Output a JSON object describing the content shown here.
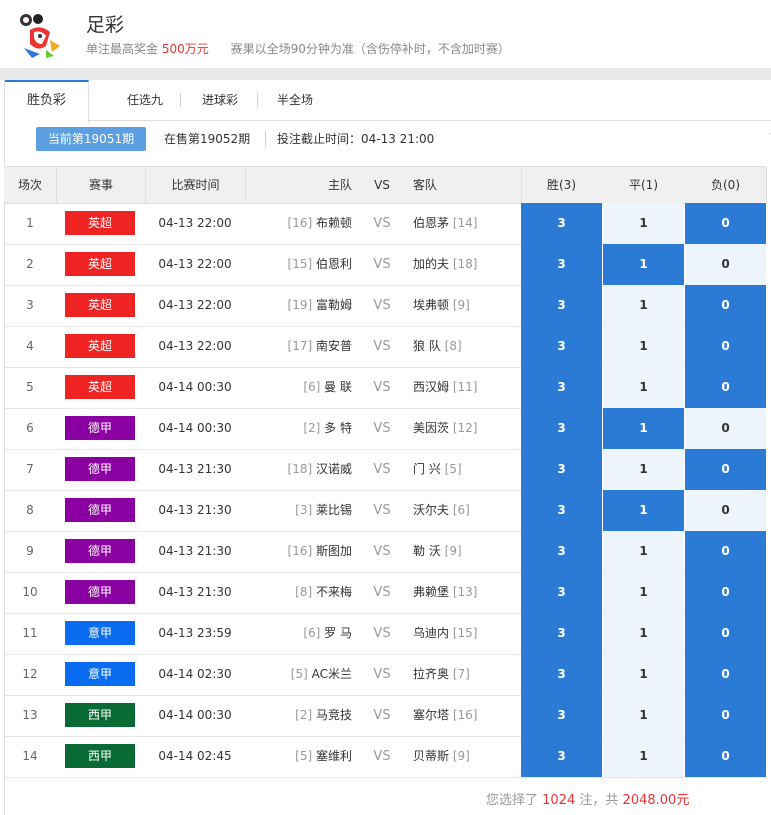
{
  "header": {
    "title": "足彩",
    "max_prize_label": "单注最高奖金",
    "max_prize_value": "500万元",
    "rule_note": "赛果以全场90分钟为准（含伤停补时，不含加时赛）"
  },
  "tabs": [
    {
      "label": "胜负彩"
    },
    {
      "label": "任选九"
    },
    {
      "label": "进球彩"
    },
    {
      "label": "半全场"
    }
  ],
  "issue": {
    "current": "当前第19051期",
    "on_sale": "在售第19052期",
    "deadline": "投注截止时间：04-13 21:00"
  },
  "table_headers": {
    "no": "场次",
    "league": "赛事",
    "time": "比赛时间",
    "home": "主队",
    "vs": "VS",
    "away": "客队",
    "win": "胜(3)",
    "draw": "平(1)",
    "lose": "负(0)"
  },
  "colors": {
    "英超": "#f02323",
    "德甲": "#8b00a0",
    "意甲": "#0a6cf0",
    "西甲": "#0a6a36",
    "selected": "#2b7bd6"
  },
  "matches": [
    {
      "no": "1",
      "league": "英超",
      "time": "04-13 22:00",
      "home_rank": "[16]",
      "home": "布赖顿",
      "away": "伯恩茅",
      "away_rank": "[14]",
      "win": "3",
      "draw": "1",
      "lose": "0",
      "sel": [
        1,
        0,
        1
      ]
    },
    {
      "no": "2",
      "league": "英超",
      "time": "04-13 22:00",
      "home_rank": "[15]",
      "home": "伯恩利",
      "away": "加的夫",
      "away_rank": "[18]",
      "win": "3",
      "draw": "1",
      "lose": "0",
      "sel": [
        1,
        1,
        0
      ]
    },
    {
      "no": "3",
      "league": "英超",
      "time": "04-13 22:00",
      "home_rank": "[19]",
      "home": "富勒姆",
      "away": "埃弗顿",
      "away_rank": "[9]",
      "win": "3",
      "draw": "1",
      "lose": "0",
      "sel": [
        1,
        0,
        1
      ]
    },
    {
      "no": "4",
      "league": "英超",
      "time": "04-13 22:00",
      "home_rank": "[17]",
      "home": "南安普",
      "away": "狼 队",
      "away_rank": "[8]",
      "win": "3",
      "draw": "1",
      "lose": "0",
      "sel": [
        1,
        0,
        1
      ]
    },
    {
      "no": "5",
      "league": "英超",
      "time": "04-14 00:30",
      "home_rank": "[6]",
      "home": "曼 联",
      "away": "西汉姆",
      "away_rank": "[11]",
      "win": "3",
      "draw": "1",
      "lose": "0",
      "sel": [
        1,
        0,
        1
      ]
    },
    {
      "no": "6",
      "league": "德甲",
      "time": "04-14 00:30",
      "home_rank": "[2]",
      "home": "多 特",
      "away": "美因茨",
      "away_rank": "[12]",
      "win": "3",
      "draw": "1",
      "lose": "0",
      "sel": [
        1,
        1,
        0
      ]
    },
    {
      "no": "7",
      "league": "德甲",
      "time": "04-13 21:30",
      "home_rank": "[18]",
      "home": "汉诺威",
      "away": "门 兴",
      "away_rank": "[5]",
      "win": "3",
      "draw": "1",
      "lose": "0",
      "sel": [
        1,
        0,
        1
      ]
    },
    {
      "no": "8",
      "league": "德甲",
      "time": "04-13 21:30",
      "home_rank": "[3]",
      "home": "莱比锡",
      "away": "沃尔夫",
      "away_rank": "[6]",
      "win": "3",
      "draw": "1",
      "lose": "0",
      "sel": [
        1,
        1,
        0
      ]
    },
    {
      "no": "9",
      "league": "德甲",
      "time": "04-13 21:30",
      "home_rank": "[16]",
      "home": "斯图加",
      "away": "勒 沃",
      "away_rank": "[9]",
      "win": "3",
      "draw": "1",
      "lose": "0",
      "sel": [
        1,
        0,
        1
      ]
    },
    {
      "no": "10",
      "league": "德甲",
      "time": "04-13 21:30",
      "home_rank": "[8]",
      "home": "不来梅",
      "away": "弗赖堡",
      "away_rank": "[13]",
      "win": "3",
      "draw": "1",
      "lose": "0",
      "sel": [
        1,
        0,
        1
      ]
    },
    {
      "no": "11",
      "league": "意甲",
      "time": "04-13 23:59",
      "home_rank": "[6]",
      "home": "罗 马",
      "away": "乌迪内",
      "away_rank": "[15]",
      "win": "3",
      "draw": "1",
      "lose": "0",
      "sel": [
        1,
        0,
        1
      ]
    },
    {
      "no": "12",
      "league": "意甲",
      "time": "04-14 02:30",
      "home_rank": "[5]",
      "home": "AC米兰",
      "away": "拉齐奥",
      "away_rank": "[7]",
      "win": "3",
      "draw": "1",
      "lose": "0",
      "sel": [
        1,
        0,
        1
      ]
    },
    {
      "no": "13",
      "league": "西甲",
      "time": "04-14 00:30",
      "home_rank": "[2]",
      "home": "马竞技",
      "away": "塞尔塔",
      "away_rank": "[16]",
      "win": "3",
      "draw": "1",
      "lose": "0",
      "sel": [
        1,
        0,
        1
      ]
    },
    {
      "no": "14",
      "league": "西甲",
      "time": "04-14 02:45",
      "home_rank": "[5]",
      "home": "塞维利",
      "away": "贝蒂斯",
      "away_rank": "[9]",
      "win": "3",
      "draw": "1",
      "lose": "0",
      "sel": [
        1,
        0,
        1
      ]
    }
  ],
  "footer": {
    "prefix": "您选择了",
    "count": "1024",
    "mid": "注，共",
    "amount": "2048.00",
    "unit": "元"
  }
}
